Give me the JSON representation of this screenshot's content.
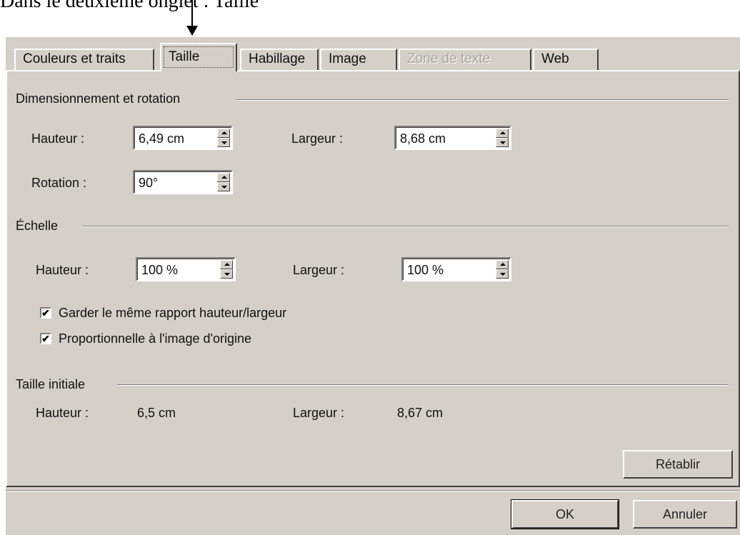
{
  "caption": "Dans le deuxième onglet : Taille",
  "tabs": [
    {
      "label": "Couleurs et traits",
      "state": "normal"
    },
    {
      "label": "Taille",
      "state": "active"
    },
    {
      "label": "Habillage",
      "state": "normal"
    },
    {
      "label": "Image",
      "state": "normal"
    },
    {
      "label": "Zone de texte",
      "state": "disabled"
    },
    {
      "label": "Web",
      "state": "normal"
    }
  ],
  "sizing": {
    "title": "Dimensionnement et rotation",
    "height_label": "Hauteur :",
    "height_value": "6,49 cm",
    "width_label": "Largeur :",
    "width_value": "8,68 cm",
    "rotation_label": "Rotation :",
    "rotation_value": "90°"
  },
  "scale": {
    "title": "Échelle",
    "height_label": "Hauteur :",
    "height_value": "100 %",
    "width_label": "Largeur :",
    "width_value": "100 %",
    "lock_aspect_label": "Garder le même rapport hauteur/largeur",
    "lock_aspect_checked": true,
    "relative_label": "Proportionnelle à l'image d'origine",
    "relative_checked": true
  },
  "original": {
    "title": "Taille initiale",
    "height_label": "Hauteur :",
    "height_value": "6,5 cm",
    "width_label": "Largeur :",
    "width_value": "8,67 cm"
  },
  "buttons": {
    "reset": "Rétablir",
    "ok": "OK",
    "cancel": "Annuler"
  },
  "check_mark": "✔"
}
